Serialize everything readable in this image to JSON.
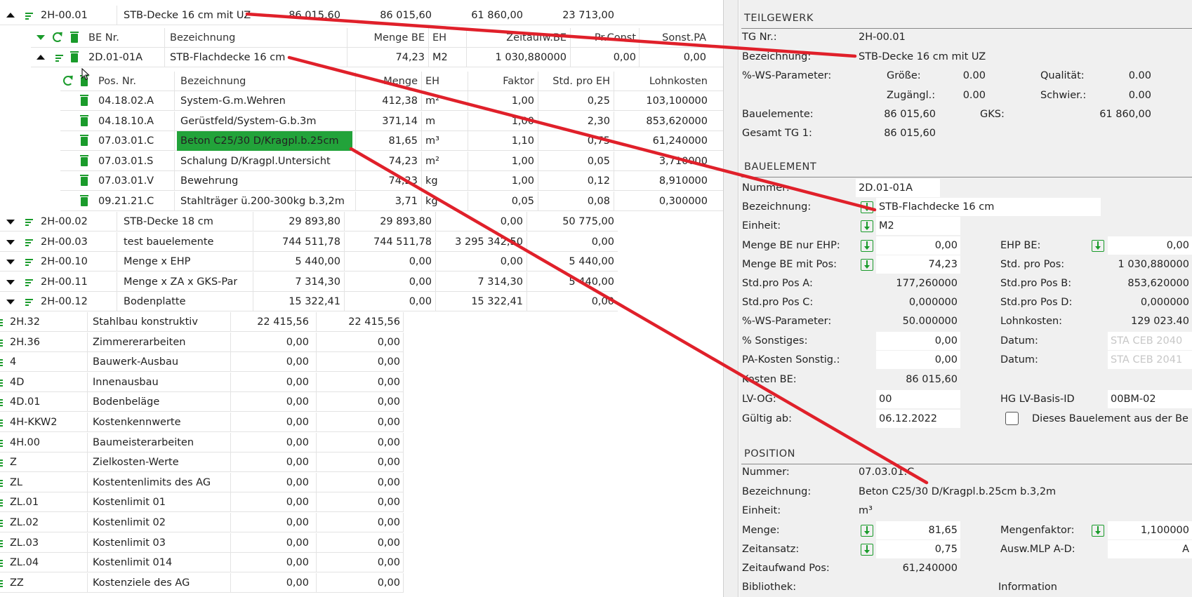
{
  "left": {
    "top_row": {
      "code": "2H-00.01",
      "name": "STB-Decke 16 cm mit UZ",
      "v1": "86 015,60",
      "v2": "86 015,60",
      "v3": "61 860,00",
      "v4": "23 713,00"
    },
    "be_header": {
      "be_nr": "BE Nr.",
      "bezeichnung": "Bezeichnung",
      "menge": "Menge BE",
      "eh": "EH",
      "zeitaufw": "Zeitaufw.BE",
      "pr_const": "Pr.Const",
      "sonst_pa": "Sonst.PA"
    },
    "be_row": {
      "nr": "2D.01-01A",
      "name": "STB-Flachdecke 16 cm",
      "menge": "74,23",
      "eh": "M2",
      "zeitaufw": "1 030,880000",
      "pr_const": "0,00",
      "sonst_pa": "0,00"
    },
    "pos_header": {
      "pos_nr": "Pos. Nr.",
      "bezeichnung": "Bezeichnung",
      "menge": "Menge",
      "eh": "EH",
      "faktor": "Faktor",
      "std": "Std. pro EH",
      "lohn": "Lohnkosten"
    },
    "positions": [
      {
        "nr": "04.18.02.A",
        "name": "System-G.m.Wehren",
        "menge": "412,38",
        "eh": "m²",
        "faktor": "1,00",
        "std": "0,25",
        "lohn": "103,100000"
      },
      {
        "nr": "04.18.10.A",
        "name": "Gerüstfeld/System-G.b.3m",
        "menge": "371,14",
        "eh": "m",
        "faktor": "1,00",
        "std": "2,30",
        "lohn": "853,620000"
      },
      {
        "nr": "07.03.01.C",
        "name": "Beton C25/30 D/Kragpl.b.25cm",
        "menge": "81,65",
        "eh": "m³",
        "faktor": "1,10",
        "std": "0,75",
        "lohn": "61,240000"
      },
      {
        "nr": "07.03.01.S",
        "name": "Schalung D/Kragpl.Untersicht",
        "menge": "74,23",
        "eh": "m²",
        "faktor": "1,00",
        "std": "0,05",
        "lohn": "3,710000"
      },
      {
        "nr": "07.03.01.V",
        "name": "Bewehrung",
        "menge": "74,23",
        "eh": "kg",
        "faktor": "1,00",
        "std": "0,12",
        "lohn": "8,910000"
      },
      {
        "nr": "09.21.21.C",
        "name": "Stahlträger ü.200-300kg b.3,2m",
        "menge": "3,71",
        "eh": "kg",
        "faktor": "0,05",
        "std": "0,08",
        "lohn": "0,300000"
      }
    ],
    "tg_rows": [
      {
        "code": "2H-00.02",
        "name": "STB-Decke 18 cm",
        "v1": "29 893,80",
        "v2": "29 893,80",
        "v3": "0,00",
        "v4": "50 775,00"
      },
      {
        "code": "2H-00.03",
        "name": "test bauelemente",
        "v1": "744 511,78",
        "v2": "744 511,78",
        "v3": "3 295 342,50",
        "v4": "0,00"
      },
      {
        "code": "2H-00.10",
        "name": "Menge x EHP",
        "v1": "5 440,00",
        "v2": "0,00",
        "v3": "0,00",
        "v4": "5 440,00"
      },
      {
        "code": "2H-00.11",
        "name": "Menge x ZA x GKS-Par",
        "v1": "7 314,30",
        "v2": "0,00",
        "v3": "7 314,30",
        "v4": "5 440,00"
      },
      {
        "code": "2H-00.12",
        "name": "Bodenplatte",
        "v1": "15 322,41",
        "v2": "0,00",
        "v3": "15 322,41",
        "v4": "0,00"
      }
    ],
    "groups": [
      {
        "code": "2H.32",
        "name": "Stahlbau konstruktiv",
        "v1": "22 415,56",
        "v2": "22 415,56"
      },
      {
        "code": "2H.36",
        "name": "Zimmererarbeiten",
        "v1": "0,00",
        "v2": "0,00"
      },
      {
        "code": "4",
        "name": "Bauwerk-Ausbau",
        "v1": "0,00",
        "v2": "0,00"
      },
      {
        "code": "4D",
        "name": "Innenausbau",
        "v1": "0,00",
        "v2": "0,00"
      },
      {
        "code": "4D.01",
        "name": "Bodenbeläge",
        "v1": "0,00",
        "v2": "0,00"
      },
      {
        "code": "4H-KKW2",
        "name": "Kostenkennwerte",
        "v1": "0,00",
        "v2": "0,00"
      },
      {
        "code": "4H.00",
        "name": "Baumeisterarbeiten",
        "v1": "0,00",
        "v2": "0,00"
      },
      {
        "code": "Z",
        "name": "Zielkosten-Werte",
        "v1": "0,00",
        "v2": "0,00"
      },
      {
        "code": "ZL",
        "name": "Kostentenlimits des AG",
        "v1": "0,00",
        "v2": "0,00"
      },
      {
        "code": "ZL.01",
        "name": "Kostenlimit 01",
        "v1": "0,00",
        "v2": "0,00"
      },
      {
        "code": "ZL.02",
        "name": "Kostenlimit 02",
        "v1": "0,00",
        "v2": "0,00"
      },
      {
        "code": "ZL.03",
        "name": "Kostenlimit 03",
        "v1": "0,00",
        "v2": "0,00"
      },
      {
        "code": "ZL.04",
        "name": "Kostenlimit 014",
        "v1": "0,00",
        "v2": "0,00"
      },
      {
        "code": "ZZ",
        "name": "Kostenziele des AG",
        "v1": "0,00",
        "v2": "0,00"
      }
    ]
  },
  "right": {
    "teilgewerk": {
      "title": "TEILGEWERK",
      "tg_nr_label": "TG Nr.:",
      "tg_nr": "2H-00.01",
      "bez_label": "Bezeichnung:",
      "bez": "STB-Decke 16 cm mit UZ",
      "ws_label": "%-WS-Parameter:",
      "groesse_label": "Größe:",
      "groesse": "0.00",
      "qualitaet_label": "Qualität:",
      "qualitaet": "0.00",
      "zugaengl_label": "Zugängl.:",
      "zugaengl": "0.00",
      "schwier_label": "Schwier.:",
      "schwier": "0.00",
      "bauelemente_label": "Bauelemente:",
      "bauelemente": "86 015,60",
      "gks_label": "GKS:",
      "gks": "61 860,00",
      "gesamt_label": "Gesamt TG 1:",
      "gesamt": "86 015,60"
    },
    "bauelement": {
      "title": "BAUELEMENT",
      "nummer_label": "Nummer:",
      "nummer": "2D.01-01A",
      "bez_label": "Bezeichnung:",
      "bez": "STB-Flachdecke 16 cm",
      "einheit_label": "Einheit:",
      "einheit": "M2",
      "menge_ehp_label": "Menge BE nur EHP:",
      "menge_ehp": "0,00",
      "ehp_be_label": "EHP BE:",
      "ehp_be": "0,00",
      "menge_pos_label": "Menge BE mit Pos:",
      "menge_pos": "74,23",
      "std_pos_label": "Std. pro Pos:",
      "std_pos": "1 030,880000",
      "std_a_label": "Std.pro Pos A:",
      "std_a": "177,260000",
      "std_b_label": "Std.pro Pos B:",
      "std_b": "853,620000",
      "std_c_label": "Std.pro Pos C:",
      "std_c": "0,000000",
      "std_d_label": "Std.pro Pos D:",
      "std_d": "0,000000",
      "ws_label": "%-WS-Parameter:",
      "ws": "50.000000",
      "lohn_label": "Lohnkosten:",
      "lohn": "129 023.40",
      "sonstiges_label": "% Sonstiges:",
      "sonstiges": "0,00",
      "datum1_label": "Datum:",
      "datum1": "STA CEB 2040",
      "pa_label": "PA-Kosten Sonstig.:",
      "pa": "0,00",
      "datum2_label": "Datum:",
      "datum2": "STA CEB 2041",
      "kosten_label": "Kosten BE:",
      "kosten": "86 015,60",
      "lvog_label": "LV-OG:",
      "lvog": "00",
      "hglv_label": "HG LV-Basis-ID",
      "hglv": "00BM-02",
      "gueltig_label": "Gültig ab:",
      "gueltig": "06.12.2022",
      "checkbox_label": "Dieses Bauelement aus der Be"
    },
    "position": {
      "title": "POSITION",
      "nummer_label": "Nummer:",
      "nummer": "07.03.01.C",
      "bez_label": "Bezeichnung:",
      "bez": "Beton C25/30 D/Kragpl.b.25cm b.3,2m",
      "einheit_label": "Einheit:",
      "einheit": "m³",
      "menge_label": "Menge:",
      "menge": "81,65",
      "mengenfaktor_label": "Mengenfaktor:",
      "mengenfaktor": "1,100000",
      "zeitansatz_label": "Zeitansatz:",
      "zeitansatz": "0,75",
      "ausw_label": "Ausw.MLP A-D:",
      "ausw": "A",
      "zeitaufwand_label": "Zeitaufwand Pos:",
      "zeitaufwand": "61,240000",
      "bibliothek_label": "Bibliothek:",
      "information_label": "Information"
    }
  },
  "colors": {
    "accent_green": "#1a9b2b",
    "highlight_bg": "#22a33a",
    "annotation_red": "#e0202a",
    "panel_bg": "#f0f0f0",
    "divider": "#9a9a9a"
  }
}
